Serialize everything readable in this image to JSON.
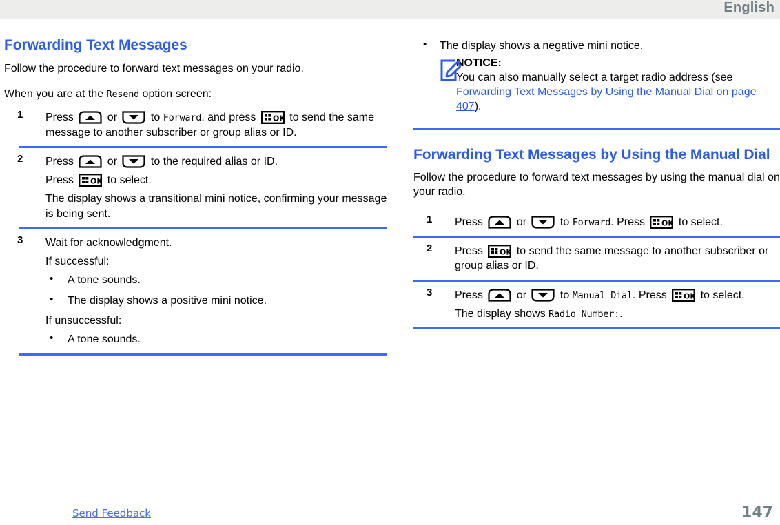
{
  "header": {
    "language": "English"
  },
  "left_column": {
    "heading": "Forwarding Text Messages",
    "intro1": "Follow the procedure to forward text messages on your radio.",
    "intro2_before": "When you are at the ",
    "intro2_mono": "Resend",
    "intro2_after": " option screen:",
    "steps": [
      {
        "number": "1",
        "lines": [
          {
            "segments": [
              {
                "type": "text",
                "value": "Press "
              },
              {
                "type": "icon",
                "value": "up-arrow-key-icon"
              },
              {
                "type": "text",
                "value": " or "
              },
              {
                "type": "icon",
                "value": "down-arrow-key-icon"
              },
              {
                "type": "text",
                "value": " to "
              },
              {
                "type": "mono",
                "value": "Forward"
              },
              {
                "type": "text",
                "value": ", and press "
              },
              {
                "type": "icon",
                "value": "ok-menu-key-icon"
              },
              {
                "type": "text",
                "value": " to send the same message to another subscriber or group alias or ID."
              }
            ]
          }
        ]
      },
      {
        "number": "2",
        "lines": [
          {
            "segments": [
              {
                "type": "text",
                "value": "Press "
              },
              {
                "type": "icon",
                "value": "up-arrow-key-icon"
              },
              {
                "type": "text",
                "value": " or "
              },
              {
                "type": "icon",
                "value": "down-arrow-key-icon"
              },
              {
                "type": "text",
                "value": " to the required alias or ID."
              }
            ]
          },
          {
            "segments": [
              {
                "type": "text",
                "value": "Press "
              },
              {
                "type": "icon",
                "value": "ok-menu-key-icon"
              },
              {
                "type": "text",
                "value": " to select."
              }
            ]
          },
          {
            "segments": [
              {
                "type": "text",
                "value": "The display shows a transitional mini notice, confirming your message is being sent."
              }
            ]
          }
        ]
      },
      {
        "number": "3",
        "lines": [
          {
            "segments": [
              {
                "type": "text",
                "value": "Wait for acknowledgment."
              }
            ]
          },
          {
            "segments": [
              {
                "type": "text",
                "value": "If successful:"
              }
            ]
          },
          {
            "type": "bullets",
            "items": [
              "A tone sounds.",
              " The display shows a positive mini notice."
            ]
          },
          {
            "segments": [
              {
                "type": "text",
                "value": "If unsuccessful:"
              }
            ]
          },
          {
            "type": "bullets",
            "items": [
              "A tone sounds."
            ]
          }
        ]
      }
    ]
  },
  "right_column": {
    "top_bullets": [
      "The display shows a negative mini notice."
    ],
    "notice": {
      "icon": "notice-pencil-icon",
      "title": "NOTICE:",
      "body_before": "You can also manually select a target radio address (see ",
      "link": "Forwarding Text Messages by Using the Manual Dial on page 407",
      "body_after": ")."
    },
    "heading": "Forwarding Text Messages by Using the Manual Dial",
    "intro": "Follow the procedure to forward text messages by using the manual dial on your radio.",
    "steps": [
      {
        "number": "1",
        "lines": [
          {
            "segments": [
              {
                "type": "text",
                "value": "Press "
              },
              {
                "type": "icon",
                "value": "up-arrow-key-icon"
              },
              {
                "type": "text",
                "value": " or "
              },
              {
                "type": "icon",
                "value": "down-arrow-key-icon"
              },
              {
                "type": "text",
                "value": " to "
              },
              {
                "type": "mono",
                "value": "Forward"
              },
              {
                "type": "text",
                "value": ". Press "
              },
              {
                "type": "icon",
                "value": "ok-menu-key-icon"
              },
              {
                "type": "text",
                "value": " to select."
              }
            ]
          }
        ]
      },
      {
        "number": "2",
        "lines": [
          {
            "segments": [
              {
                "type": "text",
                "value": "Press "
              },
              {
                "type": "icon",
                "value": "ok-menu-key-icon"
              },
              {
                "type": "text",
                "value": " to send the same message to another subscriber or group alias or ID."
              }
            ]
          }
        ]
      },
      {
        "number": "3",
        "lines": [
          {
            "segments": [
              {
                "type": "text",
                "value": "Press "
              },
              {
                "type": "icon",
                "value": "up-arrow-key-icon"
              },
              {
                "type": "text",
                "value": " or "
              },
              {
                "type": "icon",
                "value": "down-arrow-key-icon"
              },
              {
                "type": "text",
                "value": " to "
              },
              {
                "type": "mono",
                "value": "Manual Dial"
              },
              {
                "type": "text",
                "value": ". Press "
              },
              {
                "type": "icon",
                "value": "ok-menu-key-icon"
              },
              {
                "type": "text",
                "value": " to select."
              }
            ]
          },
          {
            "segments": [
              {
                "type": "text",
                "value": "The display shows "
              },
              {
                "type": "mono",
                "value": "Radio Number:"
              },
              {
                "type": "text",
                "value": "."
              }
            ]
          }
        ]
      }
    ]
  },
  "footer": {
    "feedback_label": "Send Feedback",
    "page_number": "147"
  },
  "colors": {
    "heading_blue": "#2b5ce8",
    "rule_blue": "#3b6bf0",
    "link_blue": "#2b5ce8",
    "header_grey": "#ededeb",
    "header_text": "#6f8186"
  }
}
